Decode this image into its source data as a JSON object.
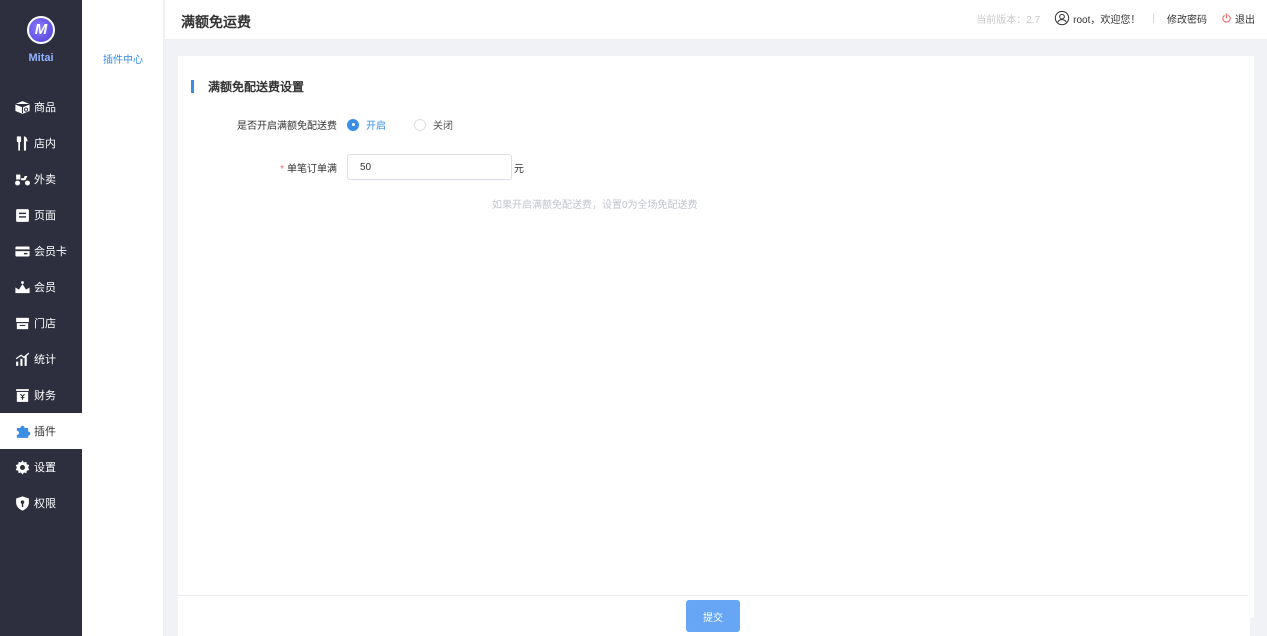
{
  "brand": {
    "name": "Mitai",
    "logo_letter": "M"
  },
  "sidebar": {
    "items": [
      {
        "label": "商品",
        "icon": "goods-icon"
      },
      {
        "label": "店内",
        "icon": "utensils-icon"
      },
      {
        "label": "外卖",
        "icon": "delivery-icon"
      },
      {
        "label": "页面",
        "icon": "page-icon"
      },
      {
        "label": "会员卡",
        "icon": "card-icon"
      },
      {
        "label": "会员",
        "icon": "crown-icon"
      },
      {
        "label": "门店",
        "icon": "store-icon"
      },
      {
        "label": "统计",
        "icon": "chart-icon"
      },
      {
        "label": "财务",
        "icon": "finance-icon"
      },
      {
        "label": "插件",
        "icon": "puzzle-icon",
        "active": true
      },
      {
        "label": "设置",
        "icon": "gear-icon"
      },
      {
        "label": "权限",
        "icon": "shield-icon"
      }
    ]
  },
  "subnav": {
    "item": "插件中心"
  },
  "header": {
    "title": "满额免运费",
    "version": "当前版本：2.7",
    "user": "root，欢迎您！",
    "separator": "|",
    "change_password": "修改密码",
    "logout": "退出"
  },
  "form": {
    "section_title": "满额免配送费设置",
    "toggle_label": "是否开启满额免配送费",
    "option_on": "开启",
    "option_off": "关闭",
    "selected": "on",
    "threshold_required_mark": "*",
    "threshold_label": "单笔订单满",
    "threshold_value": "50",
    "threshold_unit": "元",
    "hint": "如果开启满额免配送费，设置0为全场免配送费",
    "submit_label": "提交"
  },
  "colors": {
    "sidebar_bg": "#2d2e3e",
    "accent": "#3a8ee6",
    "submit_bg": "#66a6f5",
    "logout_icon": "#f56c6c"
  }
}
